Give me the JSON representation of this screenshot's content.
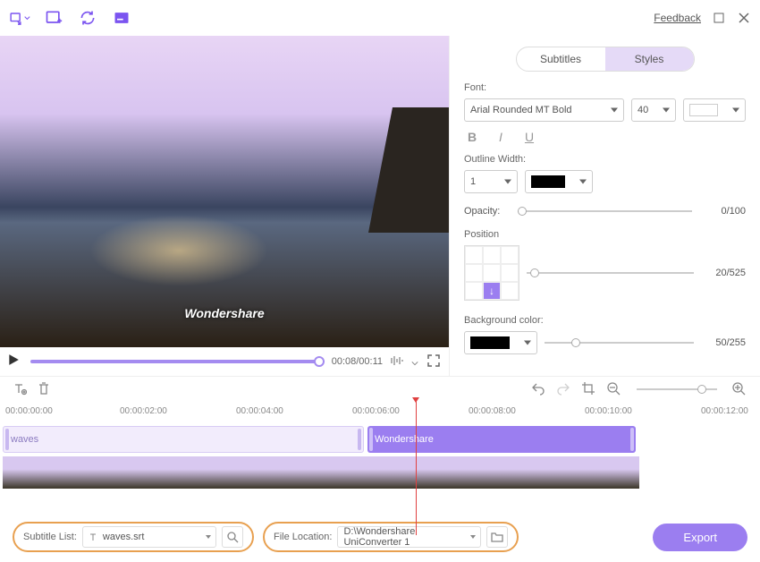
{
  "topbar": {
    "feedback": "Feedback"
  },
  "tabs": {
    "subtitles": "Subtitles",
    "styles": "Styles"
  },
  "styles": {
    "font_label": "Font:",
    "font_value": "Arial Rounded MT Bold",
    "size_value": "40",
    "outline_label": "Outline Width:",
    "outline_value": "1",
    "opacity_label": "Opacity:",
    "opacity_value": "0/100",
    "position_label": "Position",
    "position_value": "20/525",
    "bgcolor_label": "Background color:",
    "bgcolor_value": "50/255"
  },
  "preview": {
    "watermark": "Wondershare",
    "time": "00:08/00:11"
  },
  "timeline": {
    "ticks": [
      "00:00:00:00",
      "00:00:02:00",
      "00:00:04:00",
      "00:00:06:00",
      "00:00:08:00",
      "00:00:10:00",
      "00:00:12:00"
    ],
    "sub1": "waves",
    "sub2": "Wondershare"
  },
  "bottom": {
    "sublist_label": "Subtitle List:",
    "sublist_value": "waves.srt",
    "loc_label": "File Location:",
    "loc_value": "D:\\Wondershare UniConverter 1",
    "export": "Export"
  }
}
